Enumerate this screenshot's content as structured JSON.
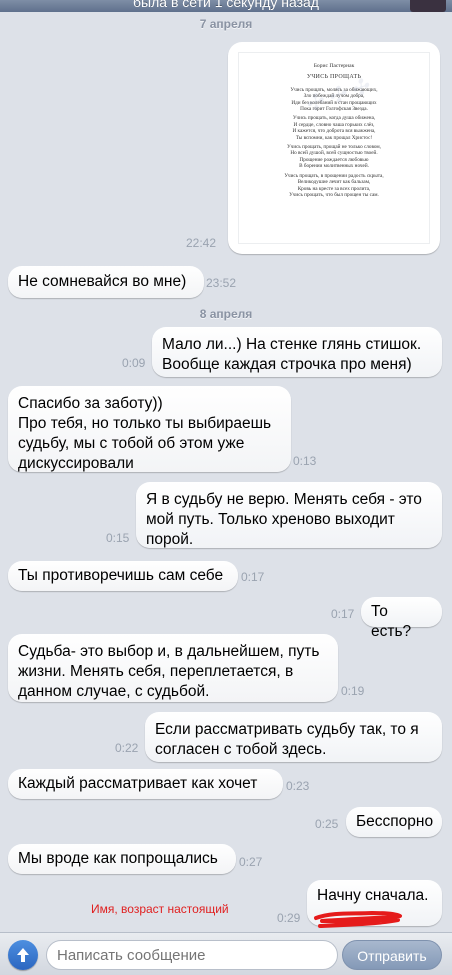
{
  "header": {
    "status_text": "была в сети 1 секунду назад"
  },
  "dates": {
    "first": "7 апреля",
    "second": "8 апреля"
  },
  "photo_message": {
    "time": "22:42",
    "poem": {
      "author": "Борис Пастернак",
      "title": "УЧИСЬ ПРОЩАТЬ",
      "lines": [
        "Учись прощать, молясь за обижающих,",
        "Зло побеждай лучом добра,",
        "Иди без колебаний в стан прощающих",
        "Пока горит Голгофская Звезда.",
        "Учись прощать, когда душа обижена,",
        "И сердце, словно чаша горьких слёз,",
        "И кажется, что доброта вся выжжена,",
        "Ты вспомни, как прощал Христос!",
        "Учись прощать, прощай не только словом,",
        "Но всей душой, всей сущностью твоей.",
        "Прощение рождается любовью",
        "В борении молитвенных ночей.",
        "Учись прощать, в прощении радость скрыта,",
        "Великодушие лечит как бальзам,",
        "Кровь на кресте за всех пролита,",
        "Учись прощать, что был прощен ты сам."
      ]
    }
  },
  "messages": [
    {
      "side": "in",
      "text": "Не сомневайся во мне)",
      "time": "23:52"
    },
    {
      "side": "out",
      "text": "Мало ли...) На стенке глянь стишок.\nВообще каждая строчка про меня)",
      "time": "0:09"
    },
    {
      "side": "in",
      "text": "Спасибо за заботу))\nПро тебя, но только ты выбираешь\nсудьбу, мы с тобой об этом уже\nдискуссировали",
      "time": "0:13"
    },
    {
      "side": "out",
      "text": "Я в судьбу не верю. Менять себя - это\nмой путь. Только хреново выходит\nпорой.",
      "time": "0:15"
    },
    {
      "side": "in",
      "text": "Ты противоречишь сам себе",
      "time": "0:17"
    },
    {
      "side": "out",
      "text": "То есть?",
      "time": "0:17"
    },
    {
      "side": "in",
      "text": "Судьба- это выбор и, в дальнейшем, путь\nжизни. Менять себя, переплетается, в\nданном случае, с судьбой.",
      "time": "0:19"
    },
    {
      "side": "out",
      "text": "Если рассматривать судьбу так, то я\nсогласен с тобой здесь.",
      "time": "0:22"
    },
    {
      "side": "in",
      "text": "Каждый рассматривает как хочет",
      "time": "0:23"
    },
    {
      "side": "out",
      "text": "Бесспорно",
      "time": "0:25"
    },
    {
      "side": "in",
      "text": "Мы вроде как попрощались",
      "time": "0:27"
    },
    {
      "side": "out",
      "text": "Начну сначала.",
      "time": "0:29"
    }
  ],
  "annotation": "Имя, возраст настоящий",
  "composer": {
    "placeholder": "Написать сообщение",
    "send_label": "Отправить"
  },
  "colors": {
    "background": "#dde1e8",
    "timestamp": "#9aa3b0",
    "annotation": "#e02020",
    "send_button": "#8499b7"
  }
}
